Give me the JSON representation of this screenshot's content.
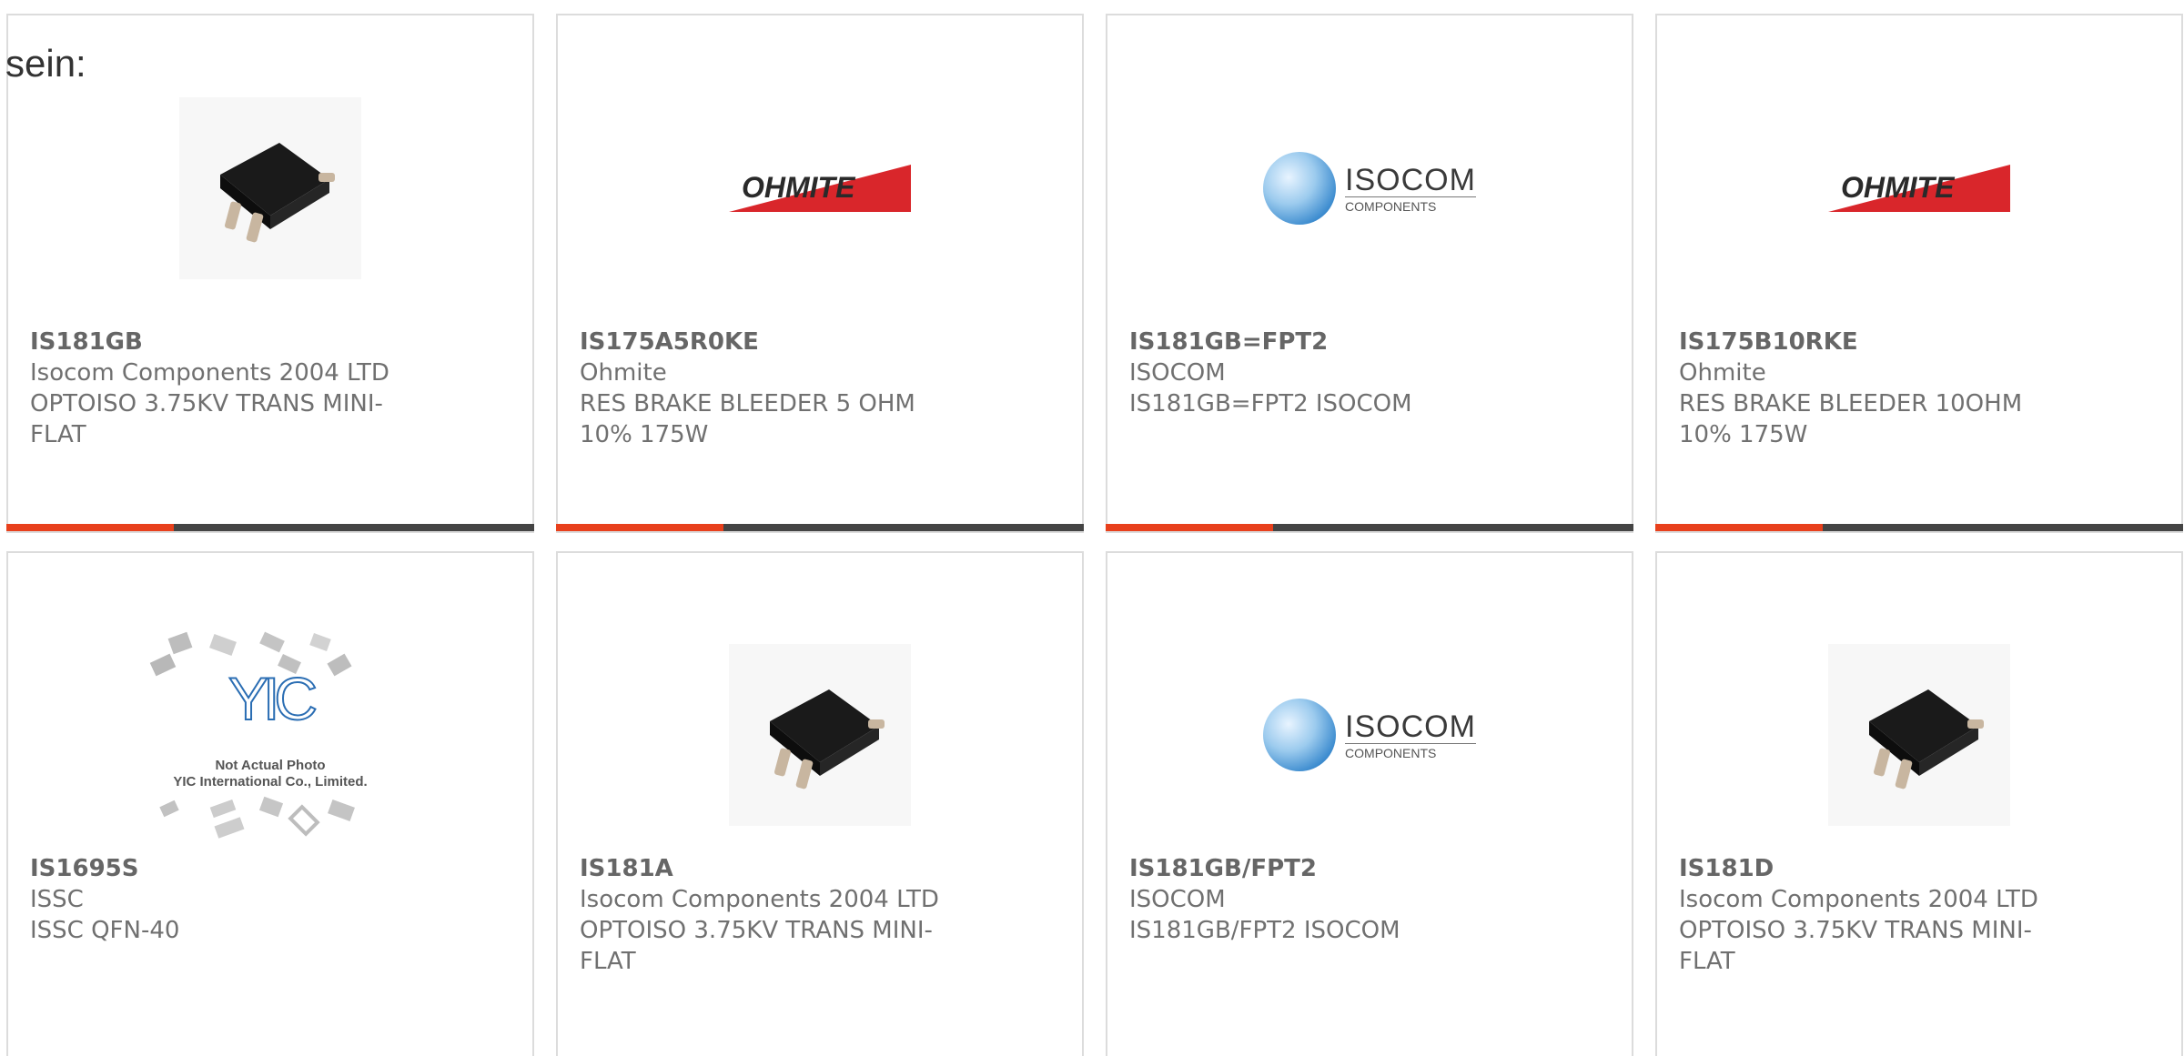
{
  "intro_text": "sein:",
  "colors": {
    "bar_accent": "#e8401c",
    "bar_base": "#444444",
    "card_border": "#dcdcdc"
  },
  "logos": {
    "ohmite": "OHMITE",
    "isocom_big": "ISOCOM",
    "isocom_small": "COMPONENTS",
    "yic_mark": "YIC",
    "yic_caption_1": "Not Actual Photo",
    "yic_caption_2": "YIC International Co., Limited."
  },
  "products": [
    {
      "part_number": "IS181GB",
      "manufacturer": "Isocom Components 2004 LTD",
      "description": "OPTOISO 3.75KV TRANS MINI-FLAT",
      "image": "chip-photo"
    },
    {
      "part_number": "IS175A5R0KE",
      "manufacturer": "Ohmite",
      "description": "RES BRAKE BLEEDER 5 OHM 10% 175W",
      "image": "ohmite-logo"
    },
    {
      "part_number": "IS181GB=FPT2",
      "manufacturer": "ISOCOM",
      "description": "IS181GB=FPT2 ISOCOM",
      "image": "isocom-logo"
    },
    {
      "part_number": "IS175B10RKE",
      "manufacturer": "Ohmite",
      "description": "RES BRAKE BLEEDER 10OHM 10% 175W",
      "image": "ohmite-logo"
    },
    {
      "part_number": "IS1695S",
      "manufacturer": "ISSC",
      "description": "ISSC QFN-40",
      "image": "yic-placeholder"
    },
    {
      "part_number": "IS181A",
      "manufacturer": "Isocom Components 2004 LTD",
      "description": "OPTOISO 3.75KV TRANS MINI-FLAT",
      "image": "chip-photo"
    },
    {
      "part_number": "IS181GB/FPT2",
      "manufacturer": "ISOCOM",
      "description": "IS181GB/FPT2 ISOCOM",
      "image": "isocom-logo"
    },
    {
      "part_number": "IS181D",
      "manufacturer": "Isocom Components 2004 LTD",
      "description": "OPTOISO 3.75KV TRANS MINI-FLAT",
      "image": "chip-photo"
    }
  ]
}
